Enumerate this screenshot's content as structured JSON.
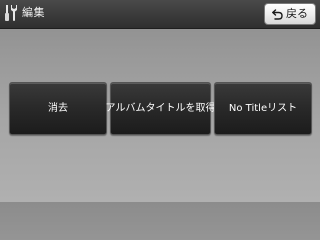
{
  "header": {
    "icon": "wrench-screwdriver-icon",
    "title": "編集",
    "back_icon": "return-arrow-icon",
    "back_label": "戻る"
  },
  "actions": [
    {
      "label": "消去"
    },
    {
      "label": "アルバムタイトルを取得"
    },
    {
      "label": "No Titleリスト"
    }
  ],
  "colors": {
    "header_background": "#3a3a3a",
    "body_background": "#a0a0a0",
    "action_button": "#2a2a2a",
    "back_button": "#eeeeee"
  }
}
